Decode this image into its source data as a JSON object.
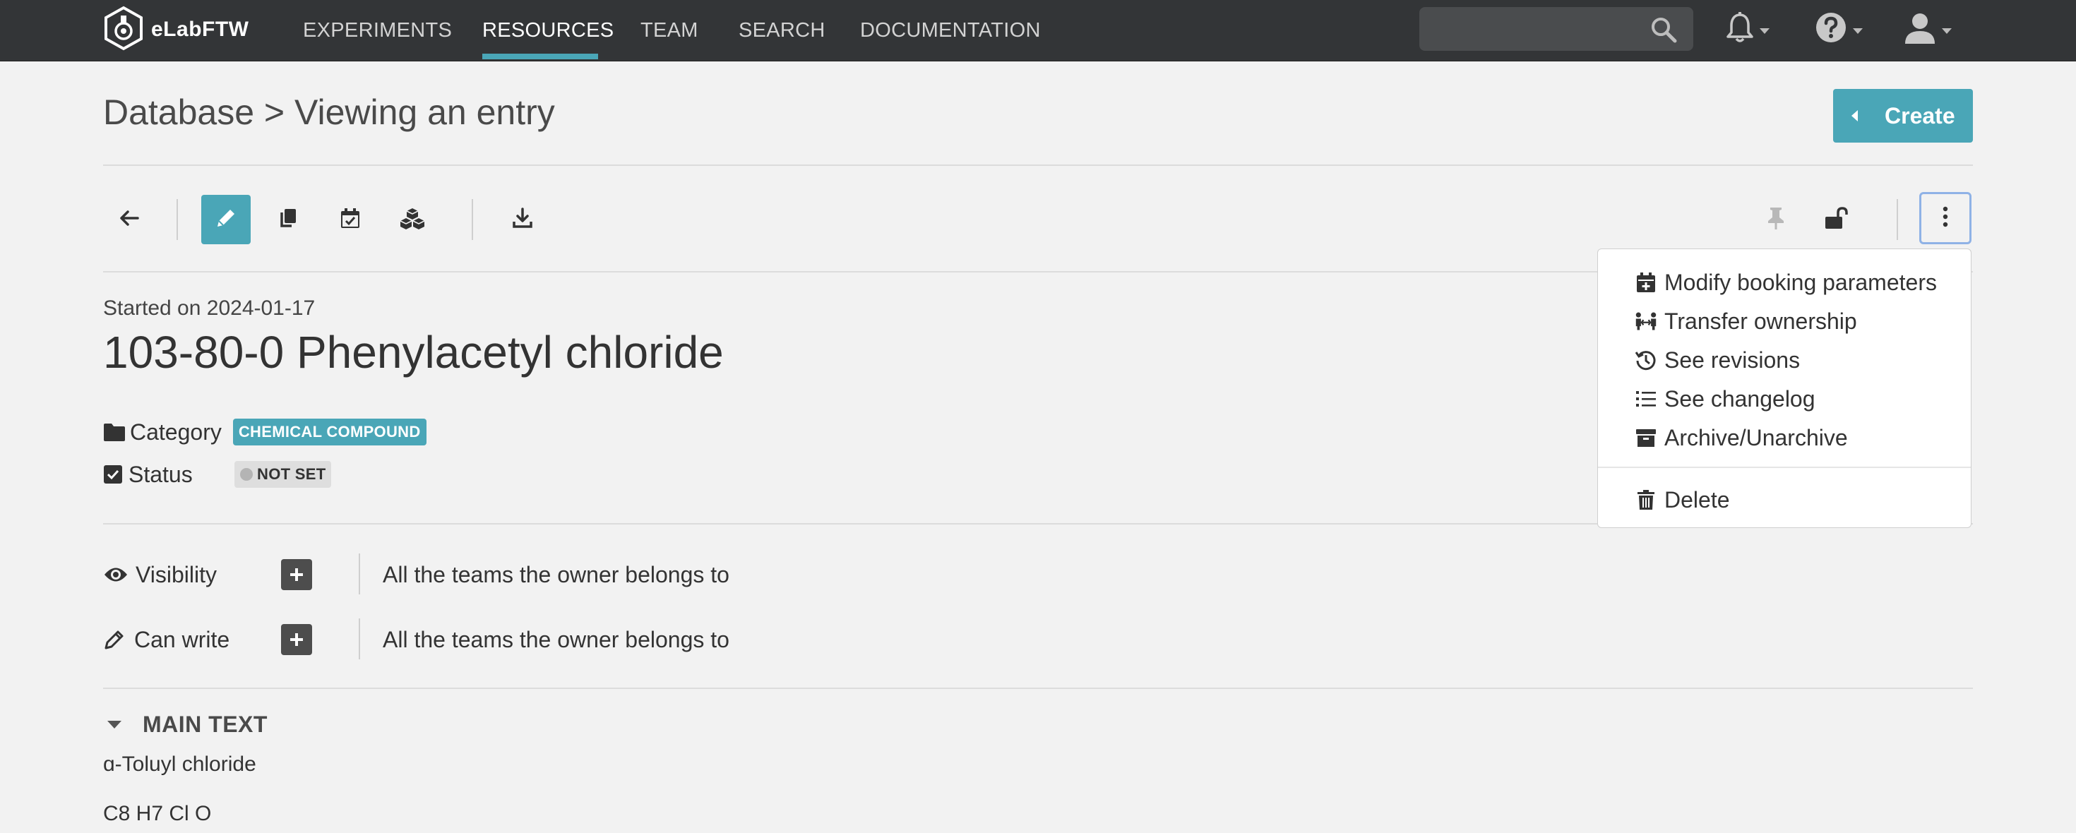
{
  "app": {
    "name": "eLabFTW"
  },
  "nav": {
    "links": [
      "EXPERIMENTS",
      "RESOURCES",
      "TEAM",
      "SEARCH",
      "DOCUMENTATION"
    ],
    "active": "RESOURCES",
    "search": {
      "value": "",
      "placeholder": ""
    }
  },
  "header": {
    "breadcrumb": "Database > Viewing an entry",
    "create_label": "Create"
  },
  "toolbar": {
    "left_icons": [
      "back-arrow-icon",
      "pencil-icon",
      "copy-icon",
      "calendar-check-icon",
      "cubes-icon",
      "download-icon"
    ],
    "right_icons": [
      "pin-icon",
      "unlock-icon",
      "ellipsis-vertical-icon"
    ],
    "active": "pencil-icon"
  },
  "entry": {
    "started": "Started on 2024-01-17",
    "title": "103-80-0 Phenylacetyl chloride",
    "category_label": "Category",
    "category_value": "CHEMICAL COMPOUND",
    "status_label": "Status",
    "status_value": "NOT SET"
  },
  "permissions": {
    "visibility_label": "Visibility",
    "visibility_value": "All the teams the owner belongs to",
    "canwrite_label": "Can write",
    "canwrite_value": "All the teams the owner belongs to"
  },
  "main_text": {
    "header": "MAIN TEXT",
    "lines": [
      "ɑ-Toluyl chloride",
      "C8 H7 Cl O"
    ]
  },
  "dropdown": {
    "items": [
      {
        "label": "Modify booking parameters",
        "icon": "calendar-plus-icon"
      },
      {
        "label": "Transfer ownership",
        "icon": "transfer-people-icon"
      },
      {
        "label": "See revisions",
        "icon": "history-icon"
      },
      {
        "label": "See changelog",
        "icon": "list-icon"
      },
      {
        "label": "Archive/Unarchive",
        "icon": "archive-box-icon"
      },
      {
        "label": "Delete",
        "icon": "trash-icon"
      }
    ]
  },
  "colors": {
    "navbar": "#333537",
    "accent": "#4aa6b7",
    "page_bg": "#f2f2f2",
    "focus_ring": "#8fb2e6"
  }
}
